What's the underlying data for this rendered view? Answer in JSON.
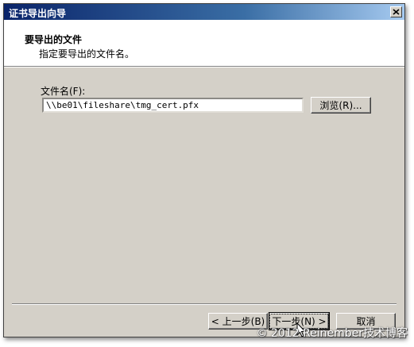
{
  "window": {
    "title": "证书导出向导"
  },
  "header": {
    "title": "要导出的文件",
    "subtitle": "指定要导出的文件名。"
  },
  "form": {
    "file_label": "文件名(F):",
    "file_value": "\\\\be01\\fileshare\\tmg_cert.pfx",
    "browse_label": "浏览(R)..."
  },
  "footer": {
    "back_label": "< 上一步(B)",
    "next_label": "下一步(N) >",
    "cancel_label": "取消"
  },
  "watermark": "© 2012 Reinember技术博客",
  "colors": {
    "titlebar_start": "#0a246a",
    "titlebar_end": "#a6caf0",
    "dialog_bg": "#d4d0c8",
    "header_bg": "#ffffff"
  },
  "icons": {
    "close": "close-icon",
    "cursor": "mouse-pointer-icon"
  }
}
